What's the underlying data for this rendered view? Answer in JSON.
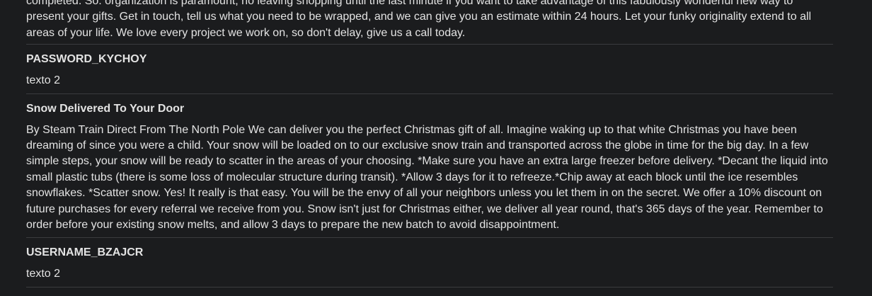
{
  "entries": [
    {
      "title": "",
      "body": "completed. So. organization is paramount, no leaving shopping until the last minute if you want to take advantage of this fabulously wonderful new way to present your gifts. Get in touch, tell us what you need to be wrapped, and we can give you an estimate within 24 hours. Let your funky originality extend to all areas of your life. We love every project we work on, so don't delay, give us a call today."
    },
    {
      "title": "PASSWORD_KYCHOY",
      "body": "texto 2"
    },
    {
      "title": "Snow Delivered To Your Door",
      "body": "By Steam Train Direct From The North Pole We can deliver you the perfect Christmas gift of all. Imagine waking up to that white Christmas you have been dreaming of since you were a child. Your snow will be loaded on to our exclusive snow train and transported across the globe in time for the big day. In a few simple steps, your snow will be ready to scatter in the areas of your choosing. *Make sure you have an extra large freezer before delivery. *Decant the liquid into small plastic tubs (there is some loss of molecular structure during transit). *Allow 3 days for it to refreeze.*Chip away at each block until the ice resembles snowflakes. *Scatter snow. Yes! It really is that easy. You will be the envy of all your neighbors unless you let them in on the secret. We offer a 10% discount on future purchases for every referral we receive from you. Snow isn't just for Christmas either, we deliver all year round, that's 365 days of the year. Remember to order before your existing snow melts, and allow 3 days to prepare the new batch to avoid disappointment."
    },
    {
      "title": "USERNAME_BZAJCR",
      "body": "texto 2"
    }
  ]
}
